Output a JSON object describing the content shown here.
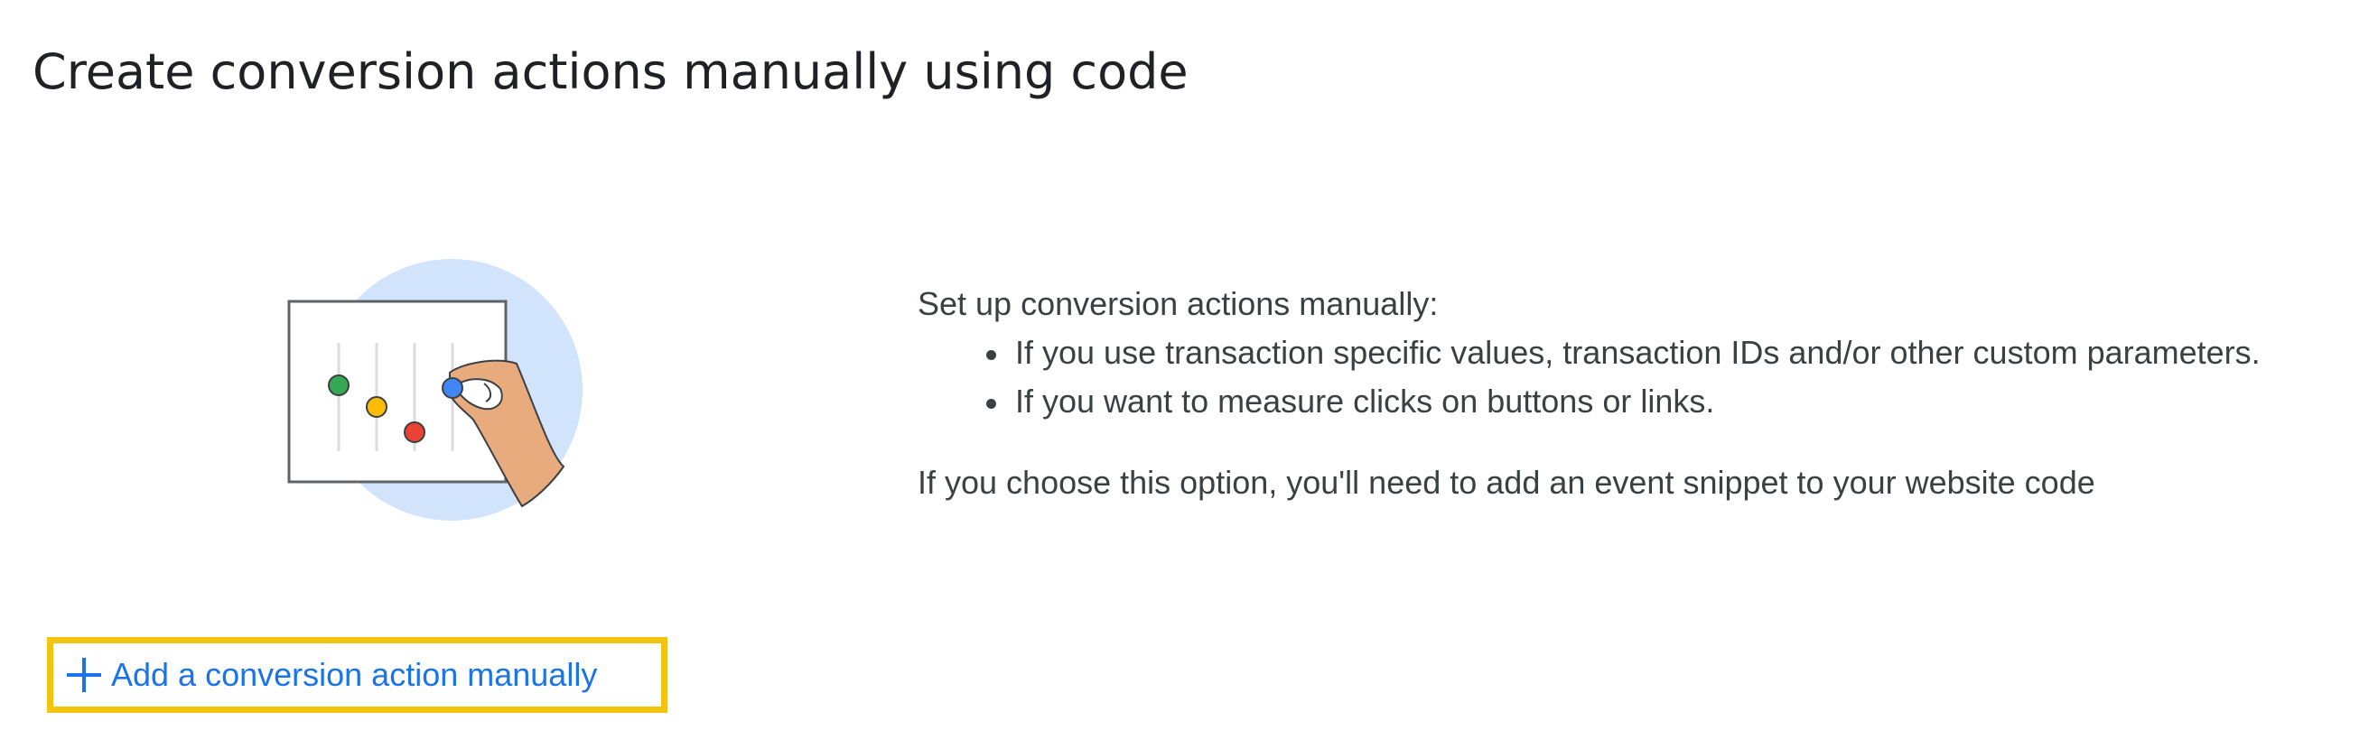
{
  "header": {
    "title": "Create conversion actions manually using code"
  },
  "illustration": {
    "icon": "equalizer-hand-illustration",
    "colors": {
      "circle": "#d2e3fc",
      "dot_green": "#34a853",
      "dot_yellow": "#fbbc04",
      "dot_red": "#ea4335",
      "dot_blue": "#4285f4",
      "skin": "#e8ab7e"
    }
  },
  "description": {
    "intro": "Set up conversion actions manually:",
    "bullets": [
      "If you use transaction specific values, transaction IDs and/or other custom parameters.",
      "If you want to measure clicks on buttons or links."
    ],
    "note": "If you choose this option, you'll need to add an event snippet to your website code"
  },
  "action": {
    "label": "Add a conversion action manually",
    "icon": "plus-icon",
    "color": "#1a73e8",
    "highlight_color": "#f2c40f"
  }
}
